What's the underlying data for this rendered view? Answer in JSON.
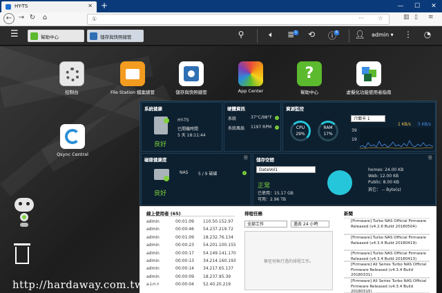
{
  "browser": {
    "tab_title": "HY-TS",
    "url": "①",
    "url_dots": "···",
    "colors": {
      "tabstrip": "#0a3a7a"
    }
  },
  "appbar": {
    "tabs": [
      {
        "label": "幫助中心"
      },
      {
        "label": "儲存與快照總管"
      }
    ],
    "notif_badge_1": "1",
    "notif_badge_2": "6",
    "user": "admin ▾"
  },
  "desktop": {
    "icons": [
      {
        "label": "控制台",
        "icon": "gear-icon",
        "color": "#e8e8e8"
      },
      {
        "label": "File Station 檔案總管",
        "icon": "folder-icon",
        "color": "#f39c1f"
      },
      {
        "label": "儲存與快照總管",
        "icon": "storage-icon",
        "color": "#2f6fb3"
      },
      {
        "label": "App Center",
        "icon": "app-grid-icon",
        "color": "#7b3fb5"
      },
      {
        "label": "幫助中心",
        "icon": "help-icon",
        "color": "#5cba2e"
      },
      {
        "label": "虛擬化功能使用者指南",
        "icon": "virtual-cube-icon",
        "color": "#3c8de3"
      },
      {
        "label": "Qsync Central",
        "icon": "sync-icon",
        "color": "#2b8fd6"
      }
    ]
  },
  "dashboard": {
    "system_health": {
      "title": "系統健康",
      "host": "HY-TS",
      "uptime_label": "已開機時間",
      "uptime": "5 天 18:11:44",
      "status": "良好"
    },
    "hardware": {
      "title": "硬體資訊",
      "rows": [
        {
          "label": "系統",
          "value": "37°C/98°F"
        },
        {
          "label": "系統風扇",
          "value": "1197 RPM"
        }
      ]
    },
    "resource": {
      "title": "資源監控",
      "cpu_label": "CPU",
      "cpu_value": "29%",
      "ram_label": "RAM",
      "ram_value": "17%",
      "nic_select": "介面卡 1",
      "upload": "1 KB/s",
      "download": "5 KB/s",
      "y_top": "39",
      "y_bottom": "19"
    },
    "disk_health": {
      "title": "磁碟健康度",
      "device": "NAS",
      "disks": "5 / 9 磁碟",
      "status": "良好"
    },
    "storage": {
      "title": "儲存空間",
      "volume_select": "DataVol1",
      "status": "正常",
      "used": "已使用：15.17 GB",
      "free": "可用：2.96 TB",
      "legend": [
        "homes: 24.00 KB",
        "Web: 12.00 KB",
        "Public: 8.00 KB",
        "其它： -- Byte(s)"
      ]
    }
  },
  "online_users": {
    "title": "線上使用者 (65)",
    "rows": [
      {
        "user": "admin",
        "time": "00:01:09",
        "ip": "110.50.152.97"
      },
      {
        "user": "admin",
        "time": "00:00:46",
        "ip": "54.237.219.72"
      },
      {
        "user": "admin",
        "time": "00:01:09",
        "ip": "18.232.76.134"
      },
      {
        "user": "admin",
        "time": "00:00:23",
        "ip": "54.201.100.155"
      },
      {
        "user": "admin",
        "time": "00:00:17",
        "ip": "54.149.141.170"
      },
      {
        "user": "admin",
        "time": "00:00:13",
        "ip": "34.214.160.193"
      },
      {
        "user": "admin",
        "time": "00:00:14",
        "ip": "34.217.65.137"
      },
      {
        "user": "admin",
        "time": "00:00:09",
        "ip": "18.237.95.39"
      },
      {
        "user": "admin",
        "time": "00:00:04",
        "ip": "52.40.20.219"
      }
    ]
  },
  "scheduled": {
    "title": "排程任務",
    "filter1": "全部工作",
    "filter2": "過去 24 小時",
    "empty_text": "無任何執行過的排程工作。"
  },
  "news": {
    "title": "新聞",
    "items": [
      "[Firmware] Turbo NAS Official Firmware Released (v4.2.6 Build 20180504)",
      "[Firmware] Turbo NAS Official Firmware Released (v4.3.4 Build 20180419)",
      "[Firmware] Turbo NAS Official Firmware Released (v4.3.4 Build 20180413)",
      "[Firmware] All Series Turbo NAS Official Firmware Released (v4.3.4 Build 20180331)",
      "[Firmware] All Series Turbo NAS Official Firmware Released (v4.3.4 Build 20180315)"
    ]
  },
  "watermark": "http://hardaway.com.tw/blog/"
}
